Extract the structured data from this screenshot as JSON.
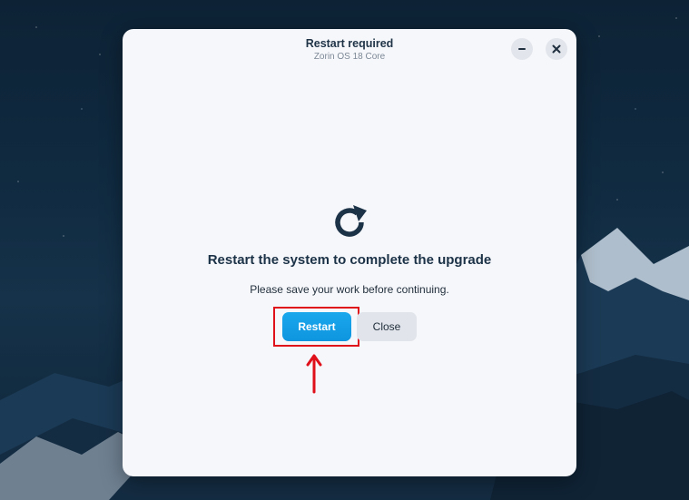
{
  "dialog": {
    "title": "Restart required",
    "subtitle": "Zorin OS 18 Core",
    "headline": "Restart the system to complete the upgrade",
    "message": "Please save your work before continuing.",
    "icon": "refresh-icon"
  },
  "buttons": {
    "restart_label": "Restart",
    "close_label": "Close"
  },
  "window_controls": {
    "minimize_icon": "minimize-icon",
    "close_icon": "close-icon"
  },
  "annotation": {
    "highlight_color": "#e0101a",
    "target": "restart-button"
  },
  "colors": {
    "accent": "#1aa7ec",
    "icon": "#1c3247",
    "dialog_bg": "#f6f7fb"
  }
}
